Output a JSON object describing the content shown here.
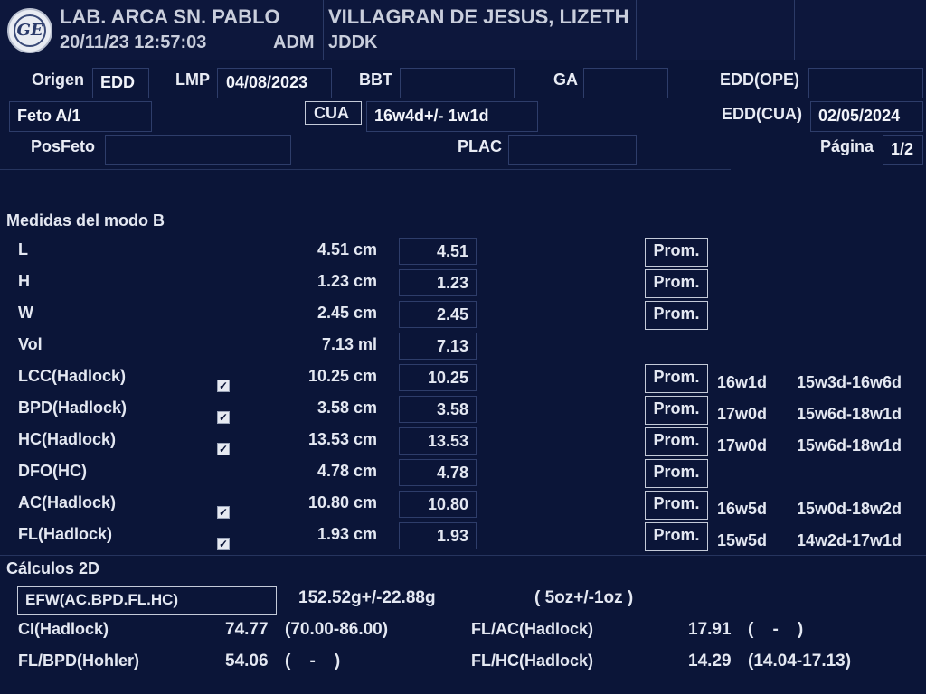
{
  "header": {
    "facility": "LAB. ARCA SN. PABLO",
    "datetime": "20/11/23 12:57:03",
    "operator": "ADM",
    "patient_name": "VILLAGRAN DE JESUS, LIZETH",
    "patient_id": "JDDK"
  },
  "info": {
    "origen_label": "Origen",
    "origen_value": "EDD",
    "lmp_label": "LMP",
    "lmp_value": "04/08/2023",
    "bbt_label": "BBT",
    "bbt_value": "",
    "ga_label": "GA",
    "ga_value": "",
    "edd_ope_label": "EDD(OPE)",
    "edd_ope_value": "",
    "feto_value": "Feto A/1",
    "cua_label": "CUA",
    "cua_value": "16w4d+/- 1w1d",
    "edd_cua_label": "EDD(CUA)",
    "edd_cua_value": "02/05/2024",
    "posfeto_label": "PosFeto",
    "posfeto_value": "",
    "plac_label": "PLAC",
    "plac_value": "",
    "pagina_label": "Página",
    "pagina_value": "1/2"
  },
  "bmode": {
    "title": "Medidas del modo B",
    "prom_label": "Prom.",
    "rows": [
      {
        "name": "L",
        "value": "4.51 cm",
        "avg": "4.51",
        "checked": false,
        "prom": true,
        "ga": "",
        "range": ""
      },
      {
        "name": "H",
        "value": "1.23 cm",
        "avg": "1.23",
        "checked": false,
        "prom": true,
        "ga": "",
        "range": ""
      },
      {
        "name": "W",
        "value": "2.45 cm",
        "avg": "2.45",
        "checked": false,
        "prom": true,
        "ga": "",
        "range": ""
      },
      {
        "name": "Vol",
        "value": "7.13 ml",
        "avg": "7.13",
        "checked": false,
        "prom": false,
        "ga": "",
        "range": ""
      },
      {
        "name": "LCC(Hadlock)",
        "value": "10.25 cm",
        "avg": "10.25",
        "checked": true,
        "prom": true,
        "ga": "16w1d",
        "range": "15w3d-16w6d"
      },
      {
        "name": "BPD(Hadlock)",
        "value": "3.58 cm",
        "avg": "3.58",
        "checked": true,
        "prom": true,
        "ga": "17w0d",
        "range": "15w6d-18w1d"
      },
      {
        "name": "HC(Hadlock)",
        "value": "13.53 cm",
        "avg": "13.53",
        "checked": true,
        "prom": true,
        "ga": "17w0d",
        "range": "15w6d-18w1d"
      },
      {
        "name": "DFO(HC)",
        "value": "4.78 cm",
        "avg": "4.78",
        "checked": false,
        "prom": true,
        "ga": "",
        "range": ""
      },
      {
        "name": "AC(Hadlock)",
        "value": "10.80 cm",
        "avg": "10.80",
        "checked": true,
        "prom": true,
        "ga": "16w5d",
        "range": "15w0d-18w2d"
      },
      {
        "name": "FL(Hadlock)",
        "value": "1.93 cm",
        "avg": "1.93",
        "checked": true,
        "prom": true,
        "ga": "15w5d",
        "range": "14w2d-17w1d"
      }
    ]
  },
  "calc": {
    "title": "Cálculos 2D",
    "efw_label": "EFW(AC.BPD.FL.HC)",
    "efw_value": "152.52g+/-22.88g",
    "efw_oz": "( 5oz+/-1oz )",
    "ci_label": "CI(Hadlock)",
    "ci_value": "74.77",
    "ci_range": "(70.00-86.00)",
    "flac_label": "FL/AC(Hadlock)",
    "flac_value": "17.91",
    "flac_range": "(    -    )",
    "flbpd_label": "FL/BPD(Hohler)",
    "flbpd_value": "54.06",
    "flbpd_range": "(    -    )",
    "flhc_label": "FL/HC(Hadlock)",
    "flhc_value": "14.29",
    "flhc_range": "(14.04-17.13)"
  },
  "logo": {
    "text": "GE"
  }
}
